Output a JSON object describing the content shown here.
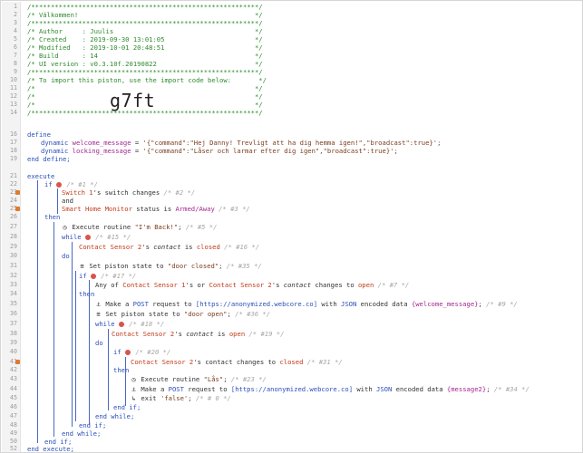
{
  "header": [
    {
      "ln": "1",
      "text": "/**********************************************************/"
    },
    {
      "ln": "2",
      "text": "/* Välkommen!                                             */"
    },
    {
      "ln": "3",
      "text": "/**********************************************************/"
    },
    {
      "ln": "4",
      "text": "/* Author     : Juulis                                    */"
    },
    {
      "ln": "5",
      "text": "/* Created    : 2019-09-30 13:01:05                       */"
    },
    {
      "ln": "6",
      "text": "/* Modified   : 2019-10-01 20:48:51                       */"
    },
    {
      "ln": "7",
      "text": "/* Build      : 14                                        */"
    },
    {
      "ln": "8",
      "text": "/* UI version : v0.3.10f.20190822                         */"
    },
    {
      "ln": "9",
      "text": "/**********************************************************/"
    },
    {
      "ln": "10",
      "text": "/* To import this piston, use the import code below:       */"
    },
    {
      "ln": "11",
      "text": "/*                                                        */"
    },
    {
      "ln": "12",
      "text": "/*                                                        */"
    },
    {
      "ln": "13",
      "text": "/*                                                        */"
    },
    {
      "ln": "14",
      "text": "/**********************************************************/"
    }
  ],
  "import_code": "g7ft",
  "define": {
    "ln_define": "16",
    "kw_define": "define",
    "ln_v1": "17",
    "kw_dynamic": "dynamic",
    "v1_name": "welcome_message",
    "v1_eq": " = ",
    "v1_value": "'{\"command\":\"Hej Danny! Trevligt att ha dig hemma igen!\",\"broadcast\":true}';",
    "ln_v2": "18",
    "v2_name": "locking_message",
    "v2_value": "'{\"command\":\"Låser och larmar efter dig igen\",\"broadcast\":true}';",
    "ln_end": "19",
    "kw_end_define": "end define;"
  },
  "execute": {
    "ln_exec": "21",
    "kw_execute": "execute",
    "ln_22": "22",
    "kw_if": "if",
    "note_22": "/* #1 */",
    "ln_23": "23",
    "dev_switch": "Switch 1",
    "txt_switch": "'s switch changes",
    "note_23": "/* #2 */",
    "ln_24": "24",
    "kw_and": "and",
    "ln_25": "25",
    "dev_shm": "Smart Home Monitor",
    "txt_shm": " status is ",
    "val_shm": "Armed/Away",
    "note_25": "/* #3 */",
    "ln_26": "26",
    "kw_then": "then",
    "ln_27": "27",
    "txt_exec_routine": "Execute routine ",
    "val_back": "\"I'm Back!\"",
    "note_27": "/* #5 */",
    "ln_28": "28",
    "kw_while": "while",
    "note_28": "/* #15 */",
    "ln_29": "29",
    "dev_cs2": "Contact Sensor 2",
    "txt_cs_is": "'s ",
    "txt_contact": "contact",
    "txt_is": " is ",
    "val_closed": "closed",
    "note_29": "/* #16 */",
    "ln_30": "30",
    "kw_do": "do",
    "ln_31": "31",
    "txt_set_state": "Set piston state to ",
    "val_door_closed": "\"door closed\"",
    "note_31": "/* #35 */",
    "ln_32": "32",
    "note_32": "/* #17 */",
    "ln_33": "33",
    "txt_any_of": "Any of ",
    "dev_cs1": "Contact Sensor 1",
    "txt_s_or": "'s or ",
    "txt_changes_to": " changes to ",
    "val_open": "open",
    "note_33": "/* #7 */",
    "ln_34": "34",
    "ln_35": "35",
    "txt_make_a": "Make a ",
    "val_post": "POST",
    "txt_request_to": " request to ",
    "val_url": "[https://anonymized.webcore.co]",
    "txt_with": " with ",
    "val_json": "JSON",
    "txt_encoded": " encoded data ",
    "val_welcome": "{welcome_message}",
    "note_35": "/* #9 */",
    "ln_36": "36",
    "val_door_open": "\"door open\"",
    "note_36": "/* #36 */",
    "ln_37": "37",
    "note_37": "/* #18 */",
    "ln_38": "38",
    "note_38": "/* #19 */",
    "ln_39": "39",
    "ln_40": "40",
    "note_40": "/* #20 */",
    "ln_41": "41",
    "txt_changes_to_closed": "'s contact changes to ",
    "note_41": "/* #31 */",
    "ln_42": "42",
    "ln_43": "43",
    "val_las": "\"Lås\"",
    "note_43": "/* #23 */",
    "ln_44": "44",
    "val_message2": "{message2}",
    "note_44": "/* #34 */",
    "ln_45": "45",
    "txt_exit": "exit ",
    "val_false": "'false'",
    "note_45": "/* # 0 */",
    "ln_46": "46",
    "kw_end_if": "end if;",
    "ln_47": "47",
    "kw_end_while": "end while;",
    "ln_48": "48",
    "ln_49": "49",
    "ln_50": "50",
    "ln_51": "51",
    "ln_52": "52",
    "kw_end_execute": "end execute;"
  },
  "colors": {
    "comment": "#2e8b2e",
    "keyword": "#2b4fb8",
    "variable": "#a2278f",
    "device": "#c13a1a",
    "note": "#a6a6a6",
    "marker": "#e07a2f"
  },
  "icons": [
    "routine-clock-icon",
    "web-request-icon",
    "set-state-icon",
    "exit-arrow-icon",
    "condition-badge-icon"
  ]
}
